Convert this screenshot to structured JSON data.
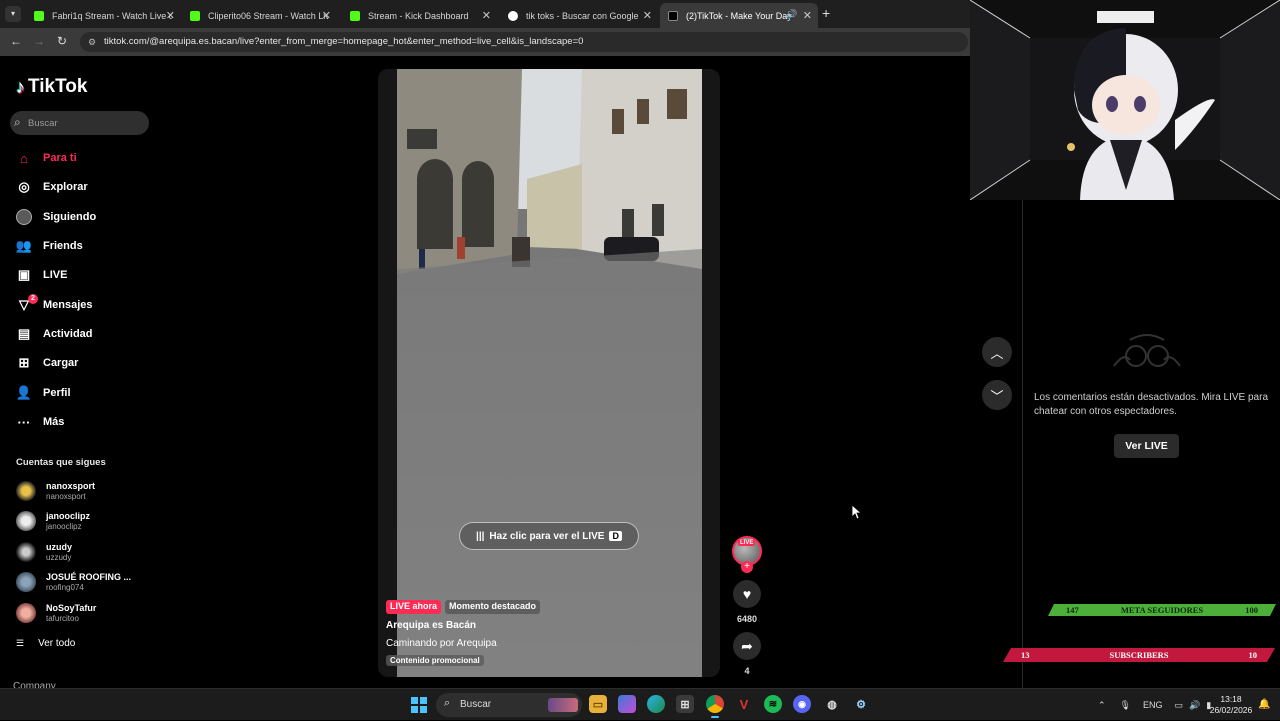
{
  "browser": {
    "tabs": [
      {
        "title": "Fabri1q Stream - Watch Live on",
        "favicon": "kick-icon",
        "color": "#53fc18"
      },
      {
        "title": "Cliperito06 Stream - Watch Live",
        "favicon": "kick-icon",
        "color": "#53fc18"
      },
      {
        "title": "Stream - Kick Dashboard",
        "favicon": "kick-icon",
        "color": "#53fc18"
      },
      {
        "title": "tik toks - Buscar con Google",
        "favicon": "google-icon",
        "color": "#ffffff"
      },
      {
        "title": "(2)TikTok - Make Your Day",
        "favicon": "tiktok-icon",
        "color": "#ffffff"
      }
    ],
    "url": "tiktok.com/@arequipa.es.bacan/live?enter_from_merge=homepage_hot&enter_method=live_cell&is_landscape=0"
  },
  "sidebar": {
    "logo": "TikTok",
    "search_placeholder": "Buscar",
    "nav": [
      {
        "label": "Para ti",
        "icon": "home-icon",
        "active": true
      },
      {
        "label": "Explorar",
        "icon": "compass-icon"
      },
      {
        "label": "Siguiendo",
        "icon": "following-avatar-icon"
      },
      {
        "label": "Friends",
        "icon": "friends-icon"
      },
      {
        "label": "LIVE",
        "icon": "live-tv-icon"
      },
      {
        "label": "Mensajes",
        "icon": "send-icon",
        "badge": "2"
      },
      {
        "label": "Actividad",
        "icon": "activity-icon"
      },
      {
        "label": "Cargar",
        "icon": "upload-icon"
      },
      {
        "label": "Perfil",
        "icon": "profile-icon"
      },
      {
        "label": "Más",
        "icon": "more-icon"
      }
    ],
    "following_title": "Cuentas que sigues",
    "following": [
      {
        "name": "nanoxsport",
        "user": "nanoxsport"
      },
      {
        "name": "janooclipz",
        "user": "janooclipz"
      },
      {
        "name": "uzudy",
        "user": "uzzudy"
      },
      {
        "name": "JOSUÉ ROOFING ...",
        "user": "roofing074"
      },
      {
        "name": "NoSoyTafur",
        "user": "tafurcitoo"
      }
    ],
    "see_all": "Ver todo",
    "company": "Company"
  },
  "video": {
    "cta": "Haz clic para ver el LIVE",
    "cta_key": "D",
    "live_pill": "LIVE ahora",
    "moment_pill": "Momento destacado",
    "title": "Arequipa es Bacán",
    "subtitle": "Caminando por Arequipa",
    "promo": "Contenido promocional"
  },
  "actions": {
    "avatar_live": "LIVE",
    "likes": "6480",
    "shares": "4"
  },
  "comments": {
    "message": "Los comentarios están desactivados. Mira LIVE para chatear con otros espectadores.",
    "button": "Ver LIVE"
  },
  "overlay": {
    "goal1": {
      "left": "147",
      "label": "META SEGUIDORES",
      "right": "100"
    },
    "goal2": {
      "left": "13",
      "label": "SUBSCRIBERS",
      "right": "10"
    }
  },
  "taskbar": {
    "search": "Buscar",
    "lang": "ENG",
    "time": "13:18",
    "date": "26/02/2026"
  }
}
